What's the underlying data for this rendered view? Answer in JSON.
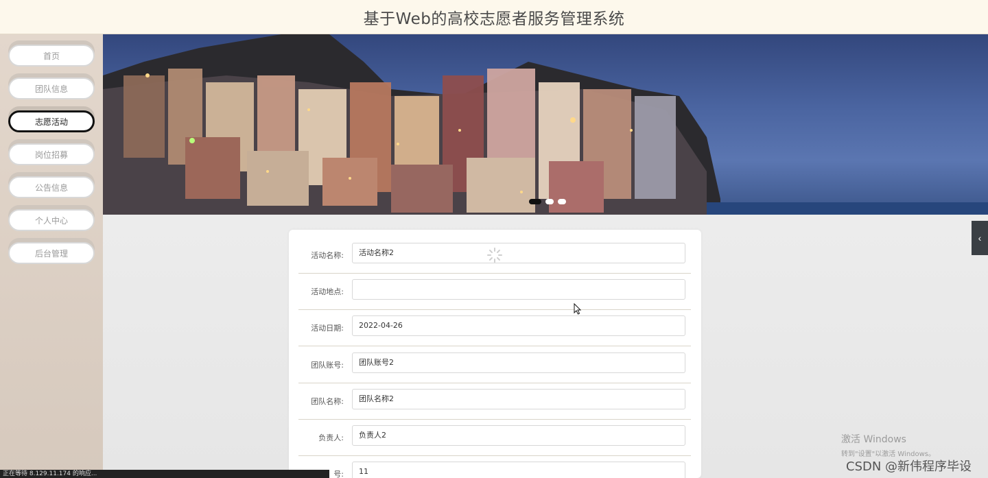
{
  "header": {
    "title": "基于Web的高校志愿者服务管理系统"
  },
  "sidebar": {
    "items": [
      {
        "label": "首页",
        "active": false
      },
      {
        "label": "团队信息",
        "active": false
      },
      {
        "label": "志愿活动",
        "active": true
      },
      {
        "label": "岗位招募",
        "active": false
      },
      {
        "label": "公告信息",
        "active": false
      },
      {
        "label": "个人中心",
        "active": false
      },
      {
        "label": "后台管理",
        "active": false
      }
    ]
  },
  "banner": {
    "slides": 3,
    "active_slide": 1
  },
  "form": {
    "fields": [
      {
        "label": "活动名称:",
        "value": "活动名称2"
      },
      {
        "label": "活动地点:",
        "value": ""
      },
      {
        "label": "活动日期:",
        "value": "2022-04-26"
      },
      {
        "label": "团队账号:",
        "value": "团队账号2"
      },
      {
        "label": "团队名称:",
        "value": "团队名称2"
      },
      {
        "label": "负责人:",
        "value": "负责人2"
      },
      {
        "label": "号:",
        "value": "11"
      }
    ]
  },
  "status_bar": {
    "text": "正在等待 8.129.11.174 的响应..."
  },
  "windows_activation": {
    "line1": "激活 Windows",
    "line2": "转到\"设置\"以激活 Windows。"
  },
  "watermark": {
    "text": "CSDN @新伟程序毕设"
  },
  "colors": {
    "header_bg": "#fdf8ec",
    "sidebar_bg": "#ddd0c4",
    "active_border": "#111111"
  }
}
